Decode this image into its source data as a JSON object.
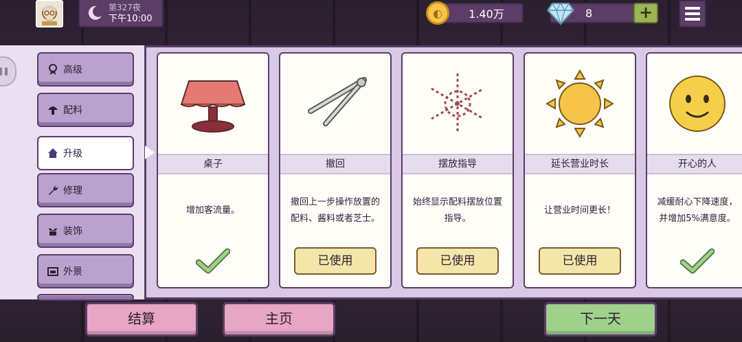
{
  "header": {
    "night_label": "第327夜",
    "time_label": "下午10:00",
    "coins": "1.40万",
    "gems": "8",
    "plus_label": "+"
  },
  "categories": [
    {
      "label": "高级",
      "icon": "ribbon-icon"
    },
    {
      "label": "配料",
      "icon": "mushroom-icon"
    },
    {
      "label": "升级",
      "icon": "house-icon",
      "active": true
    },
    {
      "label": "修理",
      "icon": "wrench-icon"
    },
    {
      "label": "装饰",
      "icon": "plant-icon"
    },
    {
      "label": "外景",
      "icon": "storefront-icon"
    }
  ],
  "cards": [
    {
      "title": "桌子",
      "desc": "增加客流量。",
      "state": "check",
      "icon": "table-icon"
    },
    {
      "title": "撤回",
      "desc": "撤回上一步操作放置的配料、酱料或者芝士。",
      "state": "used",
      "button": "已使用",
      "icon": "tongs-icon"
    },
    {
      "title": "摆放指导",
      "desc": "始终显示配料摆放位置指导。",
      "state": "used",
      "button": "已使用",
      "icon": "guide-pattern-icon"
    },
    {
      "title": "延长营业时长",
      "desc": "让营业时间更长！",
      "state": "used",
      "button": "已使用",
      "icon": "sun-icon"
    },
    {
      "title": "开心的人",
      "desc": "减缓耐心下降速度，并增加5%满意度。",
      "state": "check",
      "icon": "smiley-icon"
    }
  ],
  "footer": {
    "checkout": "结算",
    "home": "主页",
    "next_day": "下一天"
  },
  "colors": {
    "panel": "#d8c9e6",
    "border": "#5b3d66",
    "pink_button": "#e7a6c3",
    "green_button": "#9fd18b",
    "used_button": "#f4e6a8"
  }
}
